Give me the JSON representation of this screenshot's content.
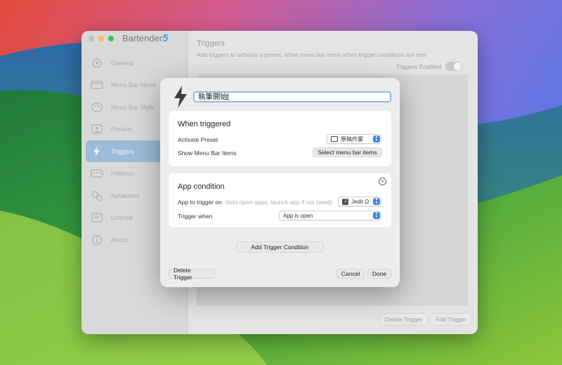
{
  "app": {
    "name": "Bartender",
    "version": "5"
  },
  "sidebar": {
    "items": [
      {
        "label": "General",
        "icon": "gear-icon"
      },
      {
        "label": "Menu Bar Items",
        "icon": "menu-bar-items-icon"
      },
      {
        "label": "Menu Bar Style",
        "icon": "palette-icon"
      },
      {
        "label": "Presets",
        "icon": "presets-icon"
      },
      {
        "label": "Triggers",
        "icon": "bolt-icon",
        "active": true
      },
      {
        "label": "Hotkeys",
        "icon": "hotkeys-icon"
      },
      {
        "label": "Advanced",
        "icon": "advanced-icon"
      },
      {
        "label": "License",
        "icon": "license-icon"
      },
      {
        "label": "About",
        "icon": "info-icon"
      }
    ]
  },
  "content": {
    "title": "Triggers",
    "description": "Add triggers to activate a preset, show menu bar items when trigger conditions are met",
    "triggers_enabled_label": "Triggers Enabled",
    "delete_trigger_label": "Delete Trigger",
    "add_trigger_label": "Add Trigger"
  },
  "sheet": {
    "trigger_name": "執筆開始",
    "when_triggered": {
      "title": "When triggered",
      "activate_preset_label": "Activate Preset",
      "activate_preset_value": "原稿作業",
      "show_items_label": "Show Menu Bar Items",
      "select_items_button": "Select menu bar items"
    },
    "app_condition": {
      "title": "App condition",
      "app_to_trigger_label": "App to trigger on",
      "app_to_trigger_hint": "(lists open apps, launch app if not listed)",
      "app_value": "Jedit Ω",
      "app_badge": "J",
      "trigger_when_label": "Trigger when",
      "trigger_when_value": "App is open"
    },
    "add_condition_button": "Add Trigger Condition",
    "delete_trigger_button": "Delete Trigger",
    "cancel_button": "Cancel",
    "done_button": "Done"
  },
  "colors": {
    "accent": "#3b82f0",
    "active_sidebar": "#9dbbd8",
    "focus_ring": "#8fb6e8"
  }
}
